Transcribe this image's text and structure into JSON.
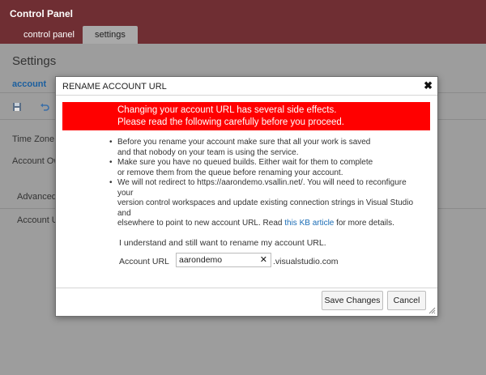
{
  "app": {
    "title": "Control Panel",
    "tabs": [
      {
        "label": "control panel",
        "active": false
      },
      {
        "label": "settings",
        "active": true
      }
    ]
  },
  "background": {
    "heading": "Settings",
    "account_link": "account",
    "fields": {
      "time_zone": "Time Zone",
      "account_owner": "Account Own",
      "advanced": "Advanced a",
      "account_url": "Account UR"
    },
    "toolbar_icons": [
      "save-icon",
      "undo-icon"
    ]
  },
  "modal": {
    "title": "RENAME ACCOUNT URL",
    "close_glyph": "✖",
    "warning_line1": "Changing your account URL has several side effects.",
    "warning_line2": "Please read the following carefully before you proceed.",
    "bullets": {
      "b1_l1": "Before you rename your account make sure that all your work is saved",
      "b1_l2": "and that nobody on your team is using the service.",
      "b2_l1": "Make sure you have no queued builds. Either wait for them to complete",
      "b2_l2": "or remove them from the queue before renaming your account.",
      "b3_l1": "We will not redirect to https://aarondemo.vsallin.net/. You will need to reconfigure your",
      "b3_l2": "version control workspaces and update existing connection strings in Visual Studio and",
      "b3_l3_prefix": "elsewhere to point to new account URL. Read ",
      "b3_link": "this KB article",
      "b3_l3_suffix": " for more details."
    },
    "understand_text": "I understand and still want to rename my account URL.",
    "url_label": "Account URL",
    "url_value": "aarondemo",
    "url_clear_glyph": "✕",
    "url_suffix": ".visualstudio.com",
    "save_label": "Save Changes",
    "cancel_label": "Cancel"
  },
  "colors": {
    "header_bg": "#6f2e33",
    "warning_bg": "#ff0000",
    "link": "#1a6cb5",
    "overlay": "#9d9d9d"
  }
}
